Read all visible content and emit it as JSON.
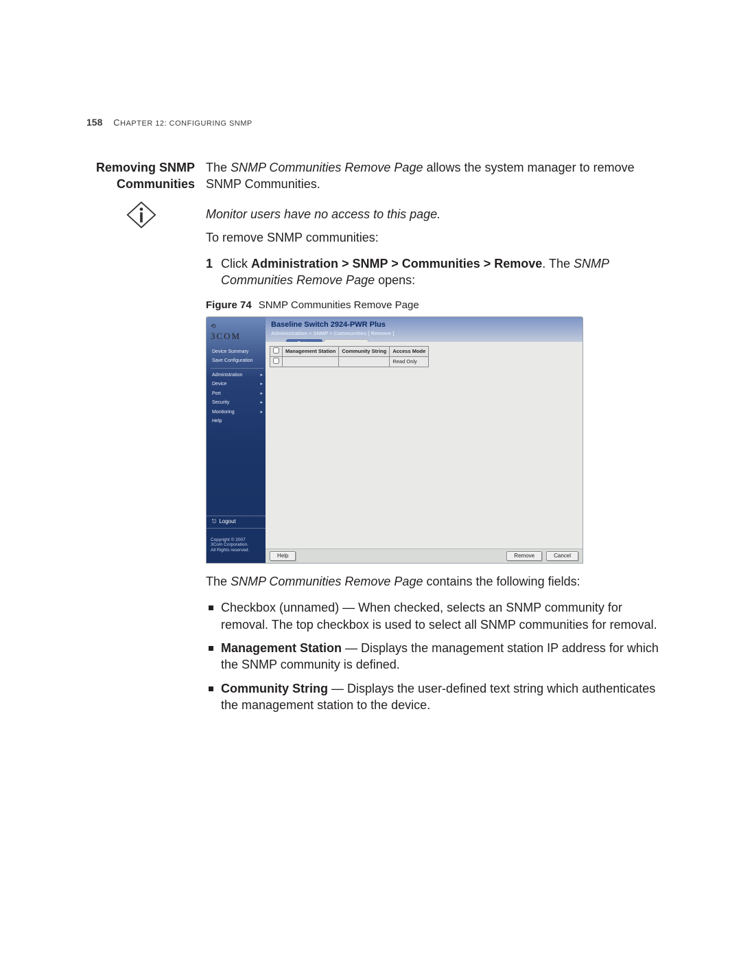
{
  "page_number": "158",
  "chapter_line_prefix": "C",
  "chapter_line_rest": "HAPTER 12: CONFIGURING SNMP",
  "section_title_l1": "Removing SNMP",
  "section_title_l2": "Communities",
  "intro_pre": "The ",
  "intro_em": "SNMP Communities Remove Page",
  "intro_post": " allows the system manager to remove SNMP Communities.",
  "note_text": "Monitor users have no access to this page.",
  "lead_in": "To remove SNMP communities:",
  "step1_num": "1",
  "step1_pre": "Click ",
  "step1_bold": "Administration > SNMP > Communities > Remove",
  "step1_mid": ". The ",
  "step1_em": "SNMP Communities Remove Page",
  "step1_post": " opens:",
  "figure_label": "Figure 74",
  "figure_caption": "SNMP Communities Remove Page",
  "after_fig_pre": "The ",
  "after_fig_em": "SNMP Communities Remove Page",
  "after_fig_post": " contains the following fields:",
  "bullets": {
    "b1": "Checkbox (unnamed) — When checked, selects an SNMP community for removal. The top checkbox is used to select all SNMP communities for removal.",
    "b2_bold": "Management Station",
    "b2_rest": " — Displays the management station IP address for which the SNMP community is defined.",
    "b3_bold": "Community String",
    "b3_rest": " — Displays the user-defined text string which authenticates the management station to the device."
  },
  "screenshot": {
    "brand_top": "⟲",
    "brand": "3COM",
    "device_title": "Baseline Switch 2924-PWR Plus",
    "breadcrumb": "Administration > SNMP > Communities [ Remove ]",
    "tabs": {
      "setup": "Setup",
      "remove": "Remove"
    },
    "sidebar": {
      "i1": "Device Summary",
      "i2": "Save Configuration",
      "i3": "Administration",
      "i4": "Device",
      "i5": "Port",
      "i6": "Security",
      "i7": "Monitoring",
      "i8": "Help"
    },
    "logout": "Logout",
    "copyright_l1": "Copyright © 2007",
    "copyright_l2": "3Com Corporation.",
    "copyright_l3": "All Rights reserved.",
    "table": {
      "h1": "Management Station",
      "h2": "Community String",
      "h3": "Access Mode",
      "row1_access": "Read Only"
    },
    "buttons": {
      "help": "Help",
      "remove": "Remove",
      "cancel": "Cancel"
    }
  }
}
